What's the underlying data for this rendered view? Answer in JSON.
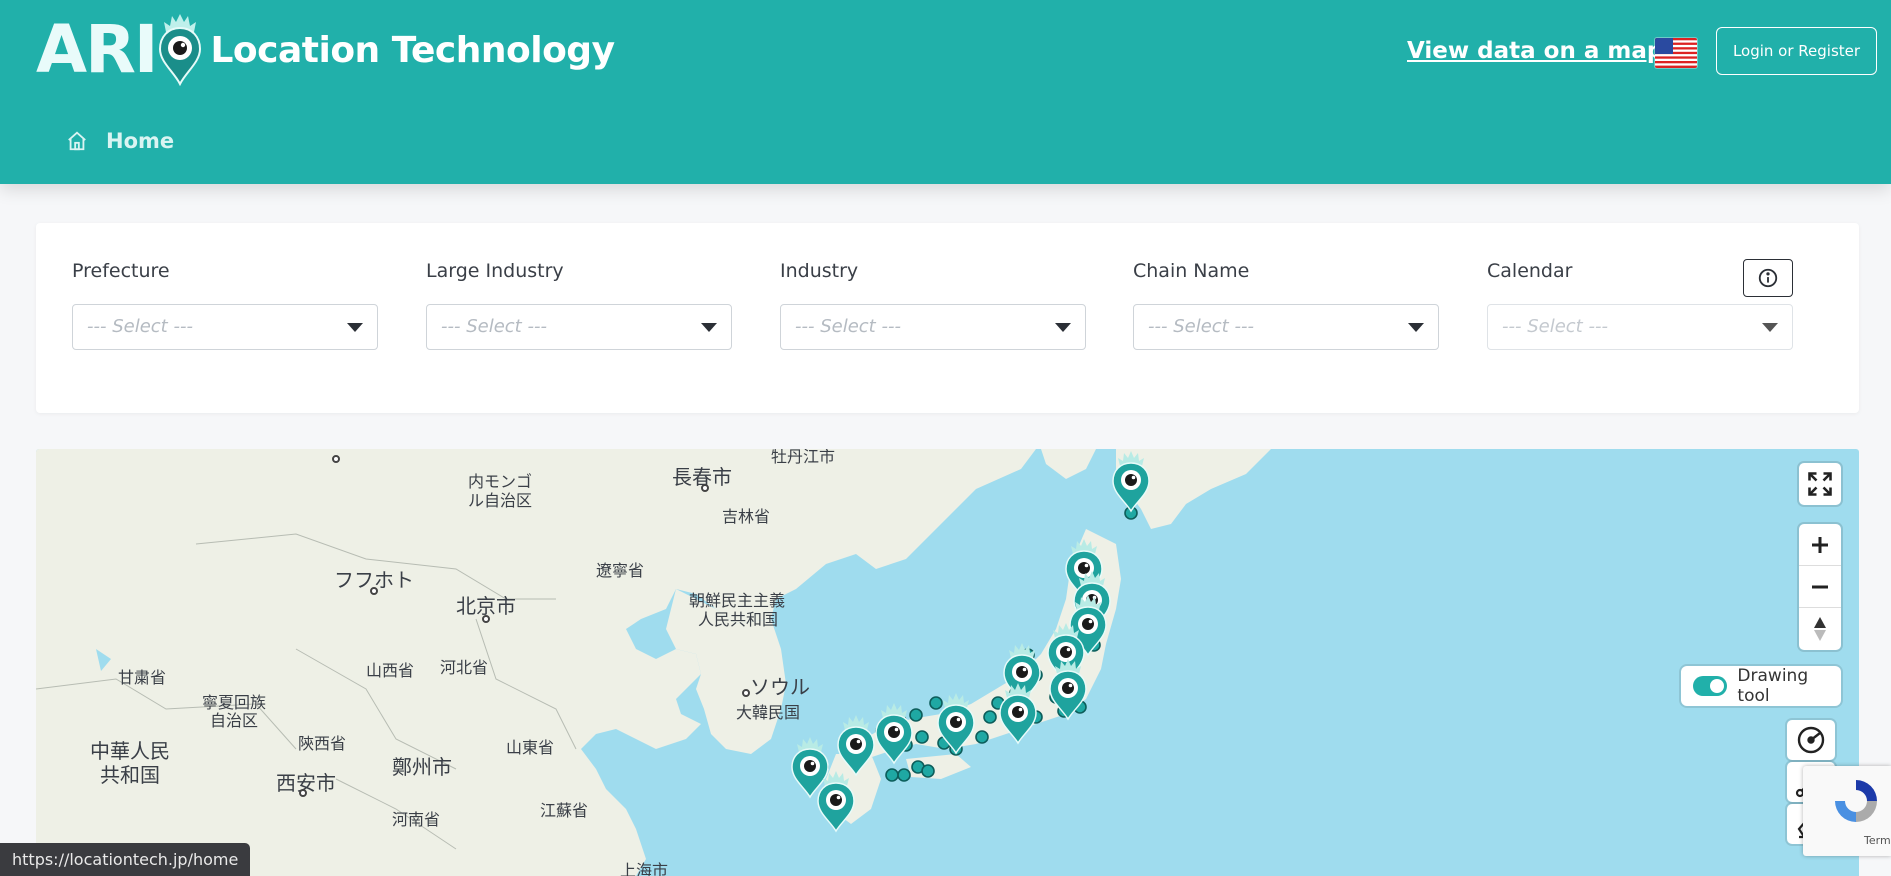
{
  "header": {
    "logo_text": "ARI",
    "brand_title": "Location Technology",
    "view_map_link": "View data on a map",
    "language_flag": "us-flag-icon",
    "login_button": "Login or Register",
    "breadcrumb_home": "Home"
  },
  "filters": {
    "items": [
      {
        "label": "Prefecture",
        "placeholder": "--- Select ---"
      },
      {
        "label": "Large Industry",
        "placeholder": "--- Select ---"
      },
      {
        "label": "Industry",
        "placeholder": "--- Select ---"
      },
      {
        "label": "Chain Name",
        "placeholder": "--- Select ---"
      },
      {
        "label": "Calendar",
        "placeholder": "--- Select ---"
      }
    ],
    "info_icon": "info-icon"
  },
  "map": {
    "labels": [
      "長春市",
      "内モンゴ",
      "ル自治区",
      "吉林省",
      "遼寧省",
      "フフホト",
      "北京市",
      "朝鮮民主主義",
      "人民共和国",
      "山西省",
      "河北省",
      "甘粛省",
      "寧夏回族",
      "自治区",
      "ソウル",
      "大韓民国",
      "中華人民",
      "共和国",
      "陝西省",
      "山東省",
      "鄭州市",
      "西安市",
      "江蘇省",
      "河南省",
      "上海市",
      "牡丹江市"
    ],
    "drawing_tool_label": "Drawing tool",
    "drawing_tool_enabled": true,
    "controls": [
      "fullscreen-icon",
      "zoom-in-icon",
      "zoom-out-icon",
      "compass-icon",
      "circle-draw-icon",
      "polygon-draw-icon",
      "eraser-icon"
    ]
  },
  "recaptcha": {
    "terms": "Terms"
  },
  "status_bar": {
    "url": "https://locationtech.jp/home"
  },
  "colors": {
    "brand": "#21b0aa",
    "sea": "#9fdcee",
    "land": "#eef0e6",
    "marker": "#1fa8a3"
  }
}
